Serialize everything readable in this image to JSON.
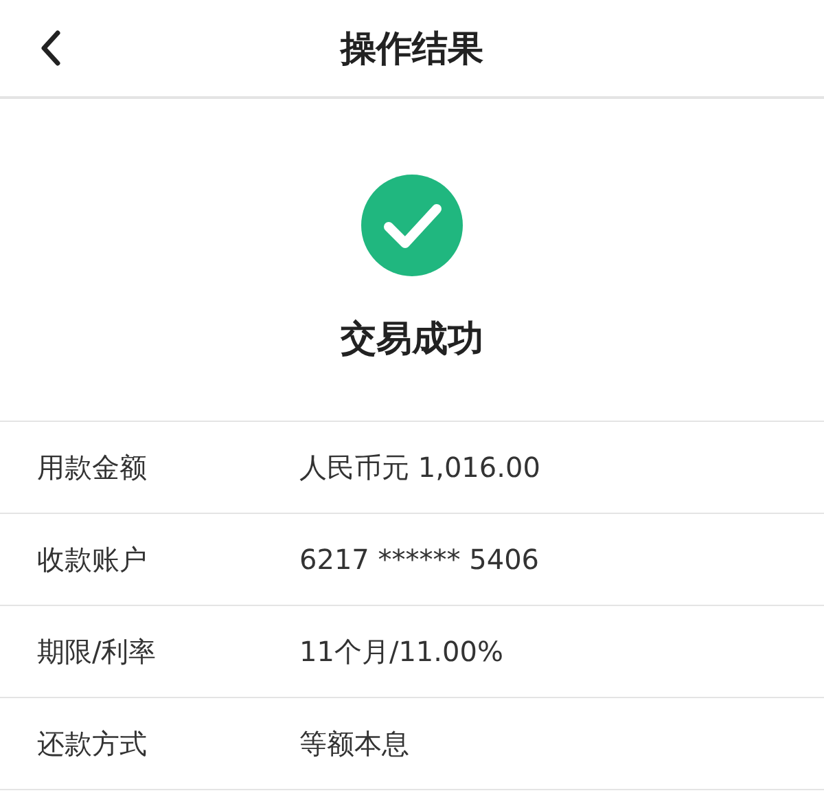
{
  "header": {
    "title": "操作结果"
  },
  "result": {
    "success": true,
    "message": "交易成功"
  },
  "rows": [
    {
      "label": "用款金额",
      "value": "人民币元 1,016.00"
    },
    {
      "label": "收款账户",
      "value": "6217 ****** 5406"
    },
    {
      "label": "期限/利率",
      "value": "11个月/11.00%"
    },
    {
      "label": "还款方式",
      "value": "等额本息"
    }
  ]
}
